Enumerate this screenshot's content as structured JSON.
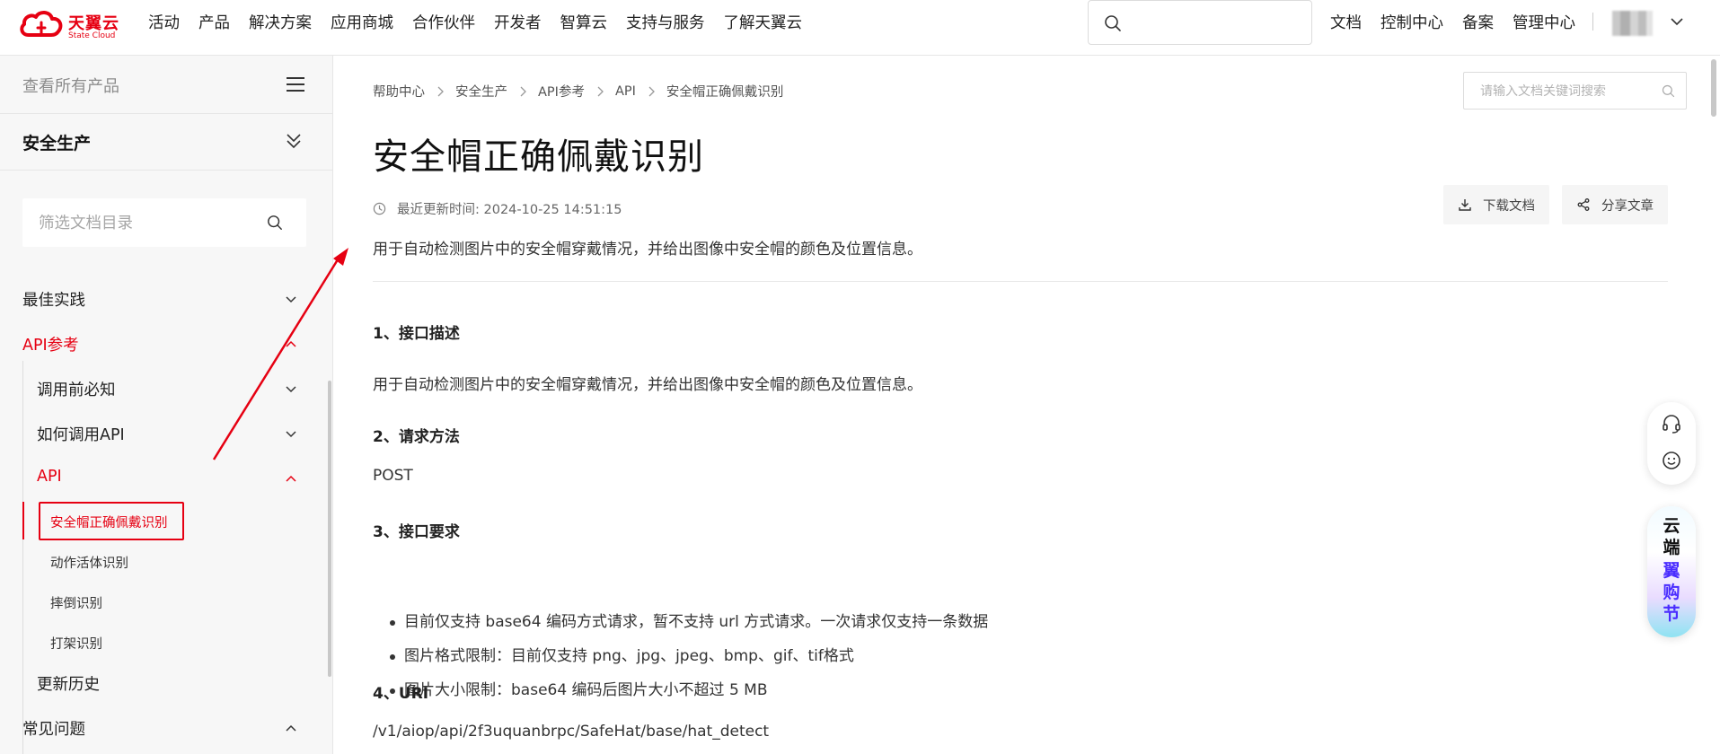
{
  "header": {
    "logo_cn": "天翼云",
    "logo_en": "State Cloud",
    "nav": [
      "活动",
      "产品",
      "解决方案",
      "应用商城",
      "合作伙伴",
      "开发者",
      "智算云",
      "支持与服务",
      "了解天翼云"
    ],
    "search_placeholder": "",
    "right_links": [
      "文档",
      "控制中心",
      "备案",
      "管理中心"
    ]
  },
  "sidebar": {
    "all_products": "查看所有产品",
    "section_title": "安全生产",
    "filter_placeholder": "筛选文档目录",
    "items": {
      "best_practice": "最佳实践",
      "api_ref": "API参考",
      "before_call": "调用前必知",
      "how_to_call": "如何调用API",
      "api": "API",
      "hat_detect": "安全帽正确佩戴识别",
      "motion_detect": "动作活体识别",
      "fall_detect": "摔倒识别",
      "fight_detect": "打架识别",
      "history": "更新历史",
      "faq": "常见问题"
    }
  },
  "main": {
    "breadcrumb": [
      "帮助中心",
      "安全生产",
      "API参考",
      "API",
      "安全帽正确佩戴识别"
    ],
    "doc_search_placeholder": "请输入文档关键词搜索",
    "title": "安全帽正确佩戴识别",
    "updated": "最近更新时间: 2024-10-25 14:51:15",
    "download_label": "下载文档",
    "share_label": "分享文章",
    "summary": "用于自动检测图片中的安全帽穿戴情况，并给出图像中安全帽的颜色及位置信息。",
    "sections": {
      "s1_title": "1、接口描述",
      "s1_text": "用于自动检测图片中的安全帽穿戴情况，并给出图像中安全帽的颜色及位置信息。",
      "s2_title": "2、请求方法",
      "s2_text": "POST",
      "s3_title": "3、接口要求",
      "s3_bullets": [
        "目前仅支持 base64 编码方式请求，暂不支持 url 方式请求。一次请求仅支持一条数据",
        "图片格式限制：目前仅支持 png、jpg、jpeg、bmp、gif、tif格式",
        "图片大小限制：base64 编码后图片大小不超过 5 MB"
      ],
      "s4_title": "4、URI",
      "s4_text": "/v1/aiop/api/2f3uquanbrpc/SafeHat/base/hat_detect"
    }
  },
  "promo": {
    "top": "云端",
    "bottom": "翼购节"
  },
  "icons": {
    "search": "search-icon",
    "menu": "menu-icon",
    "collapse": "double-chevron-down-icon",
    "clock": "clock-icon",
    "download": "download-icon",
    "share": "share-icon",
    "headset": "headset-icon",
    "smiley": "smiley-icon"
  },
  "colors": {
    "brand": "#e60012",
    "promo_text": "#4a2dff"
  }
}
